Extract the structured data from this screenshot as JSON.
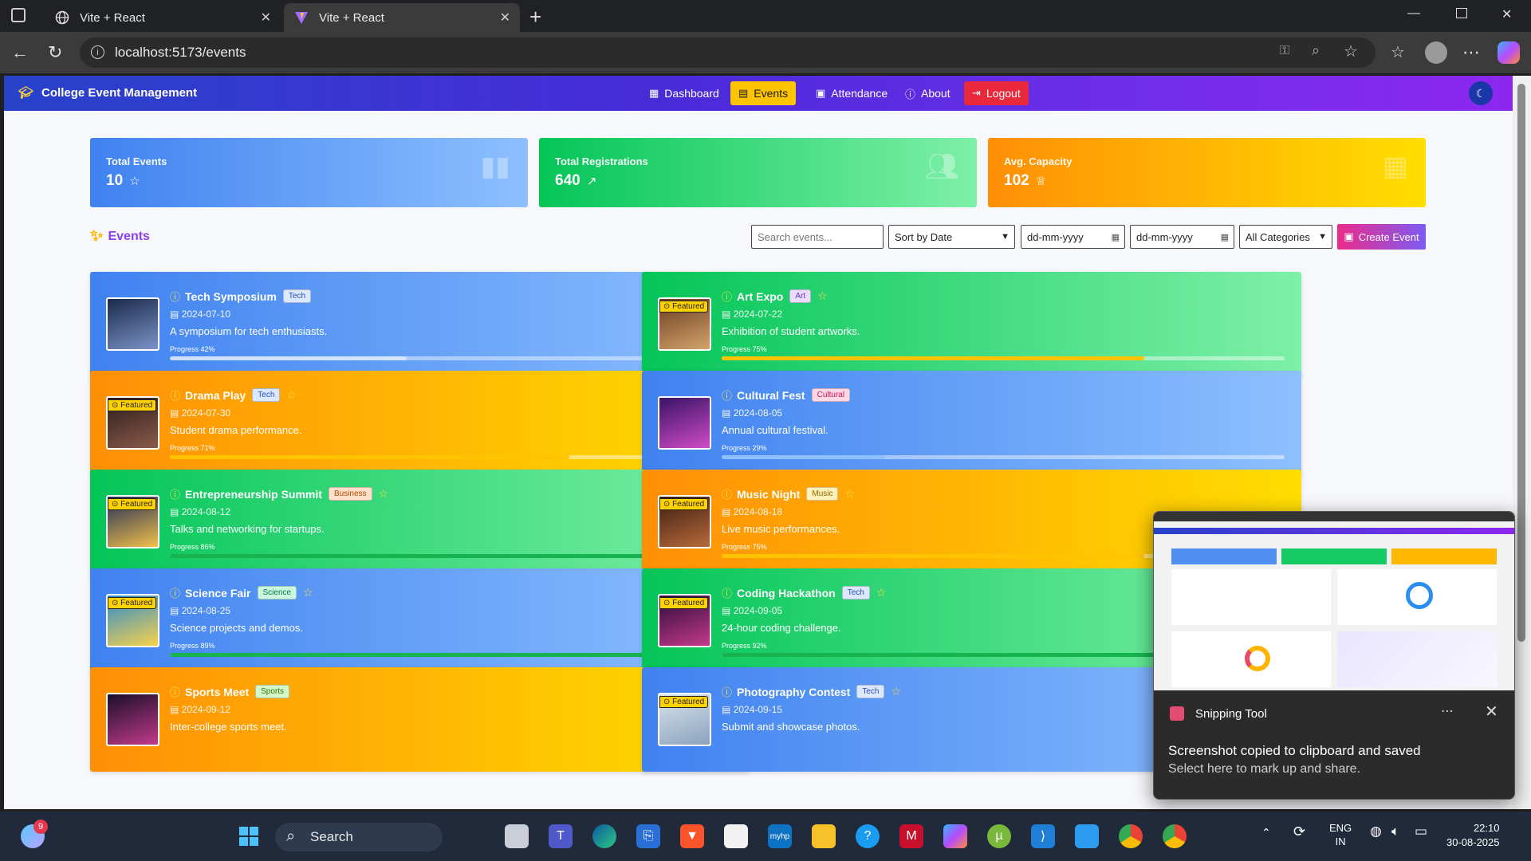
{
  "browser": {
    "tabs": [
      {
        "label": "Vite + React"
      },
      {
        "label": "Vite + React"
      }
    ],
    "url": "localhost:5173/events"
  },
  "navbar": {
    "brand": "College Event Management",
    "links": {
      "dashboard": "Dashboard",
      "events": "Events",
      "attendance": "Attendance",
      "about": "About",
      "logout": "Logout"
    }
  },
  "stats": [
    {
      "label": "Total Events",
      "value": "10"
    },
    {
      "label": "Total Registrations",
      "value": "640"
    },
    {
      "label": "Avg. Capacity",
      "value": "102"
    }
  ],
  "events_section": {
    "title": "Events",
    "search_placeholder": "Search events...",
    "sort_value": "Sort by Date",
    "date_from": "dd-mm-yyyy",
    "date_to": "dd-mm-yyyy",
    "category_value": "All Categories",
    "create_label": "Create Event"
  },
  "events": [
    {
      "title": "Tech Symposium",
      "category": "Tech",
      "date": "2024-07-10",
      "description": "A symposium for tech enthusiasts.",
      "progress_label": "Progress  42%",
      "progress": 0.42,
      "featured": false,
      "starred": false
    },
    {
      "title": "Art Expo",
      "category": "Art",
      "date": "2024-07-22",
      "description": "Exhibition of student artworks.",
      "progress_label": "Progress  75%",
      "progress": 0.75,
      "featured": true,
      "starred": true
    },
    {
      "title": "Drama Play",
      "category": "Tech",
      "date": "2024-07-30",
      "description": "Student drama performance.",
      "progress_label": "Progress  71%",
      "progress": 0.71,
      "featured": true,
      "starred": true
    },
    {
      "title": "Cultural Fest",
      "category": "Cultural",
      "date": "2024-08-05",
      "description": "Annual cultural festival.",
      "progress_label": "Progress  29%",
      "progress": 0.29,
      "featured": false,
      "starred": false
    },
    {
      "title": "Entrepreneurship Summit",
      "category": "Business",
      "date": "2024-08-12",
      "description": "Talks and networking for startups.",
      "progress_label": "Progress  86%",
      "progress": 0.86,
      "featured": true,
      "starred": true
    },
    {
      "title": "Music Night",
      "category": "Music",
      "date": "2024-08-18",
      "description": "Live music performances.",
      "progress_label": "Progress  75%",
      "progress": 0.75,
      "featured": true,
      "starred": true
    },
    {
      "title": "Science Fair",
      "category": "Science",
      "date": "2024-08-25",
      "description": "Science projects and demos.",
      "progress_label": "Progress  89%",
      "progress": 0.89,
      "featured": true,
      "starred": true
    },
    {
      "title": "Coding Hackathon",
      "category": "Tech",
      "date": "2024-09-05",
      "description": "24-hour coding challenge.",
      "progress_label": "Progress  92%",
      "progress": 0.92,
      "featured": true,
      "starred": true
    },
    {
      "title": "Sports Meet",
      "category": "Sports",
      "date": "2024-09-12",
      "description": "Inter-college sports meet.",
      "progress_label": "",
      "progress": 0,
      "featured": false,
      "starred": false
    },
    {
      "title": "Photography Contest",
      "category": "Tech",
      "date": "2024-09-15",
      "description": "Submit and showcase photos.",
      "progress_label": "",
      "progress": 0,
      "featured": true,
      "starred": true
    }
  ],
  "featured_label": "Featured",
  "toast": {
    "app": "Snipping Tool",
    "message": "Screenshot copied to clipboard and saved",
    "sub": "Select here to mark up and share."
  },
  "taskbar": {
    "search": "Search",
    "notif_count": "9",
    "lang": "ENG",
    "region": "IN",
    "time": "22:10",
    "date": "30-08-2025"
  }
}
